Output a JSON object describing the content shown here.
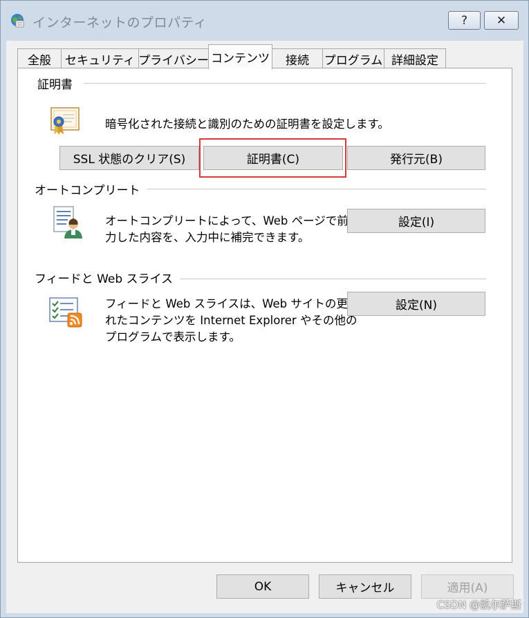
{
  "window": {
    "title": "インターネットのプロパティ",
    "help_label": "?",
    "close_label": "✕"
  },
  "tabs": [
    {
      "label": "全般"
    },
    {
      "label": "セキュリティ"
    },
    {
      "label": "プライバシー"
    },
    {
      "label": "コンテンツ",
      "active": true
    },
    {
      "label": "接続"
    },
    {
      "label": "プログラム"
    },
    {
      "label": "詳細設定"
    }
  ],
  "certificates": {
    "heading": "証明書",
    "description": "暗号化された接続と識別のための証明書を設定します。",
    "clear_ssl_label": "SSL 状態のクリア(S)",
    "certificates_label": "証明書(C)",
    "publishers_label": "発行元(B)"
  },
  "autocomplete": {
    "heading": "オートコンプリート",
    "description_line1": "オートコンプリートによって、Web ページで前回入",
    "description_line2": "力した内容を、入力中に補完できます。",
    "settings_label": "設定(I)"
  },
  "feeds": {
    "heading": "フィードと Web スライス",
    "description_line1": "フィードと Web スライスは、Web サイトの更新さ",
    "description_line2": "れたコンテンツを Internet Explorer やその他の",
    "description_line3": "プログラムで表示します。",
    "settings_label": "設定(N)"
  },
  "footer": {
    "ok_label": "OK",
    "cancel_label": "キャンセル",
    "apply_label": "適用(A)"
  },
  "watermark": "CSDN @凯尔萨斯",
  "colors": {
    "highlight": "#d23a3a",
    "window_frame": "#cfdbe8"
  }
}
